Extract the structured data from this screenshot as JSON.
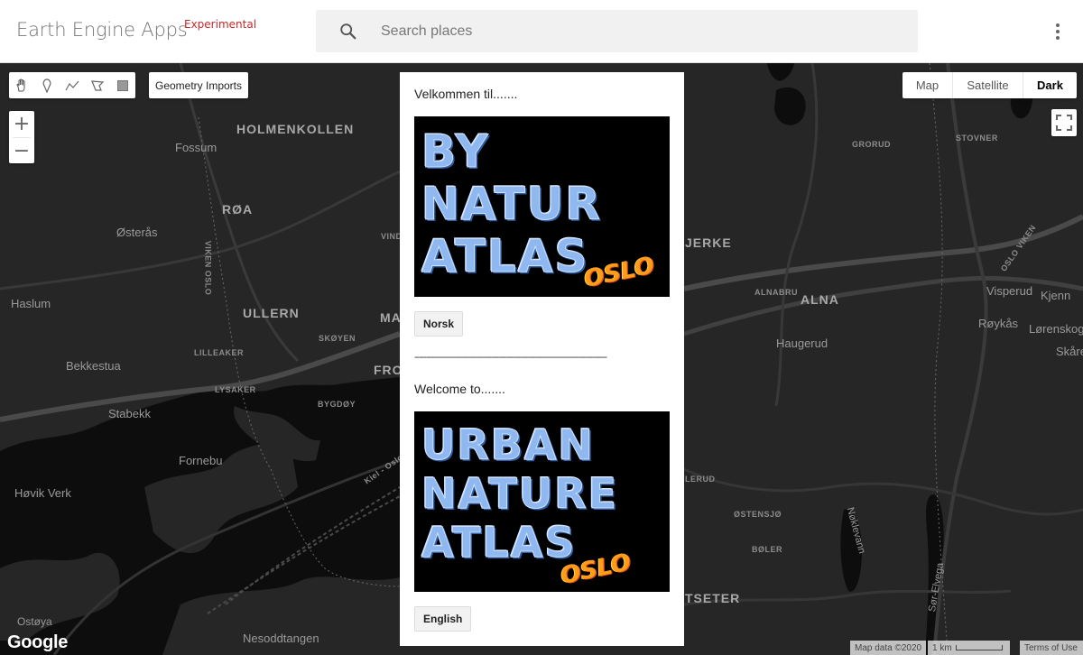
{
  "header": {
    "brand": "Earth Engine Apps",
    "badge": "Experimental",
    "search_placeholder": "Search places",
    "search_icon": "search-icon",
    "menu_icon": "more-vert-icon"
  },
  "toolbar": {
    "tools": [
      "pan-hand-icon",
      "marker-icon",
      "line-icon",
      "polygon-icon",
      "rectangle-icon"
    ],
    "geometry_imports": "Geometry Imports"
  },
  "zoom": {
    "in": "+",
    "out": "−"
  },
  "map_type": {
    "options": [
      "Map",
      "Satellite",
      "Dark"
    ],
    "selected": "Dark"
  },
  "panel": {
    "greeting_no": "Velkommen til.......",
    "banner_no": {
      "lines": [
        "BY",
        "NATUR",
        "ATLAS"
      ],
      "logo": "OSLO"
    },
    "button_no": "Norsk",
    "separator": "--------------------------------------------------------------------------------",
    "greeting_en": "Welcome to.......",
    "banner_en": {
      "lines": [
        "URBAN",
        "NATURE",
        "ATLAS"
      ],
      "logo": "OSLO"
    },
    "button_en": "English"
  },
  "map_labels": {
    "holmenkollen": "HOLMENKOLLEN",
    "fossum": "Fossum",
    "roa": "RØA",
    "osteras": "Østerås",
    "vind": "VIND",
    "haslum": "Haslum",
    "ullern": "ULLERN",
    "ma": "MA",
    "lilleaker": "LILLEAKER",
    "skoyen": "SKØYEN",
    "fro": "FRO",
    "bekkestua": "Bekkestua",
    "lysaker": "LYSAKER",
    "bygdoy": "BYGDØY",
    "stabekk": "Stabekk",
    "fornebu": "Fornebu",
    "hovik_verk": "Høvik Verk",
    "ostoya": "Ostøya",
    "nesoddtangen": "Nesoddtangen",
    "grorud": "GRORUD",
    "stovner": "STOVNER",
    "jerke": "JERKE",
    "alnabru": "ALNABRU",
    "alna": "ALNA",
    "visperud": "Visperud",
    "kjenn": "Kjenn",
    "roykas": "Røykås",
    "lorenskog": "Lørenskog",
    "skare": "Skåre",
    "haugerud": "Haugerud",
    "lerud": "LERUD",
    "ostensjo": "ØSTENSJØ",
    "boler": "BØLER",
    "tseter": "TSETER",
    "oslo_viken_1": "OSLO\nVIKEN",
    "viken_oslo": "VIKEN OSLO",
    "kiel_oslo": "Kiel - Oslo",
    "noklevann": "Nøklevann",
    "sor_elvega": "Sør-Elvega"
  },
  "footer": {
    "google": "Google",
    "map_data": "Map data ©2020",
    "scale": "1 km",
    "terms": "Terms of Use"
  },
  "colors": {
    "map_bg": "#262626",
    "water": "#0d0d0d",
    "road": "#3c3c3c",
    "badge": "#c62828"
  }
}
